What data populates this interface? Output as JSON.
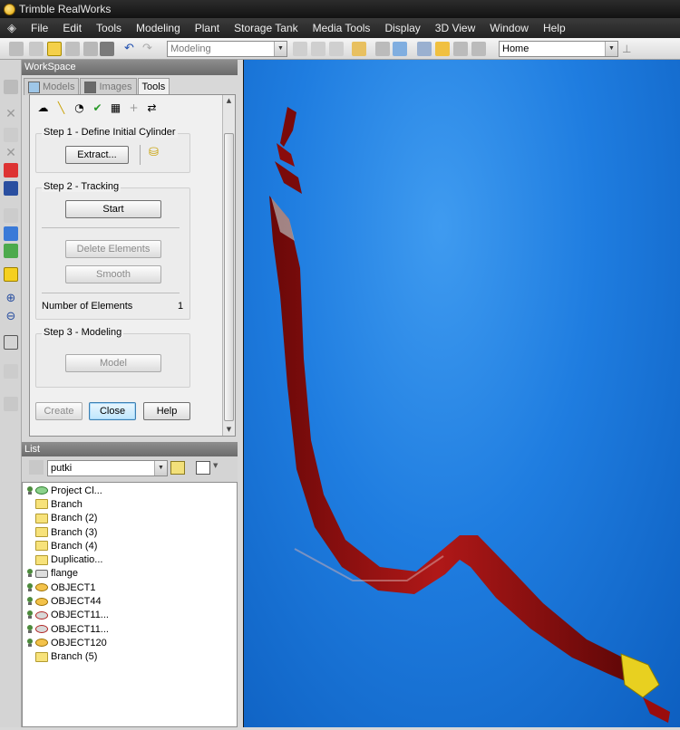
{
  "window": {
    "title": "Trimble RealWorks"
  },
  "menu": [
    "File",
    "Edit",
    "Tools",
    "Modeling",
    "Plant",
    "Storage Tank",
    "Media Tools",
    "Display",
    "3D View",
    "Window",
    "Help"
  ],
  "toolbar": {
    "mode_value": "Modeling",
    "view_value": "Home"
  },
  "workspace": {
    "title": "WorkSpace",
    "tabs": [
      {
        "label": "Models",
        "active": false
      },
      {
        "label": "Images",
        "active": false
      },
      {
        "label": "Tools",
        "active": true
      }
    ]
  },
  "tools": {
    "step1": {
      "title": "Step 1 - Define Initial Cylinder",
      "extract_label": "Extract..."
    },
    "step2": {
      "title": "Step 2 - Tracking",
      "start_label": "Start",
      "delete_label": "Delete Elements",
      "smooth_label": "Smooth",
      "elements_label": "Number of Elements",
      "elements_value": "1"
    },
    "step3": {
      "title": "Step 3 - Modeling",
      "model_label": "Model"
    },
    "create_label": "Create",
    "close_label": "Close",
    "help_label": "Help"
  },
  "list": {
    "title": "List",
    "filter_value": "putki",
    "items": [
      {
        "label": "Project Cl...",
        "icon": "project-icon"
      },
      {
        "label": "Branch",
        "icon": "folder-icon"
      },
      {
        "label": "Branch (2)",
        "icon": "folder-icon"
      },
      {
        "label": "Branch (3)",
        "icon": "folder-icon"
      },
      {
        "label": "Branch (4)",
        "icon": "folder-icon"
      },
      {
        "label": "Duplicatio...",
        "icon": "folder-icon"
      },
      {
        "label": "flange",
        "icon": "flange-icon"
      },
      {
        "label": "OBJECT1",
        "icon": "object-icon"
      },
      {
        "label": "OBJECT44",
        "icon": "object-icon"
      },
      {
        "label": "OBJECT11...",
        "icon": "object-icon"
      },
      {
        "label": "OBJECT11...",
        "icon": "object-icon"
      },
      {
        "label": "OBJECT120",
        "icon": "object-icon"
      },
      {
        "label": "Branch (5)",
        "icon": "folder-icon"
      }
    ]
  },
  "colors": {
    "viewport_bg": "#1f7de0",
    "pipe": "#a01010",
    "flange": "#e8d020"
  }
}
